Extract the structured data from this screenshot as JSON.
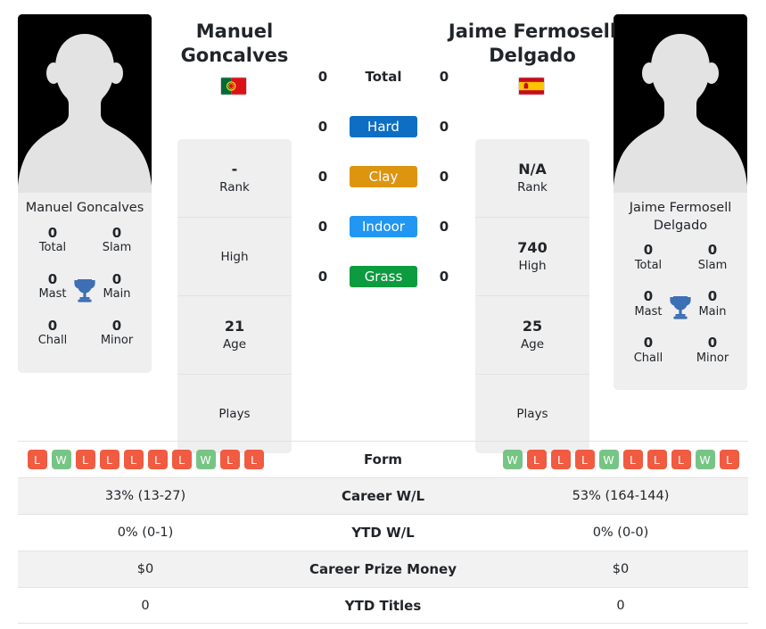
{
  "players": {
    "left": {
      "name": "Manuel\nGoncalves",
      "photo_name": "Manuel\nGoncalves",
      "country": "Portugal",
      "flag_icon": "flag-portugal-icon",
      "titles": [
        {
          "value": "0",
          "label": "Total"
        },
        {
          "value": "0",
          "label": "Slam"
        },
        {
          "value": "0",
          "label": "Mast"
        },
        {
          "value": "0",
          "label": "Main"
        },
        {
          "value": "0",
          "label": "Chall"
        },
        {
          "value": "0",
          "label": "Minor"
        }
      ],
      "info": [
        {
          "value": "-",
          "label": "Rank"
        },
        {
          "value": "",
          "label": "High"
        },
        {
          "value": "21",
          "label": "Age"
        },
        {
          "value": "",
          "label": "Plays"
        }
      ],
      "surface_wins": [
        "0",
        "0",
        "0",
        "0",
        "0"
      ],
      "form": [
        "L",
        "W",
        "L",
        "L",
        "L",
        "L",
        "L",
        "W",
        "L",
        "L"
      ],
      "career_wl": "33% (13-27)",
      "ytd_wl": "0% (0-1)",
      "career_prize_money": "$0",
      "ytd_titles": "0"
    },
    "right": {
      "name": "Jaime Fermosell\nDelgado",
      "photo_name": "Jaime Fermosell\nDelgado",
      "country": "Spain",
      "flag_icon": "flag-spain-icon",
      "titles": [
        {
          "value": "0",
          "label": "Total"
        },
        {
          "value": "0",
          "label": "Slam"
        },
        {
          "value": "0",
          "label": "Mast"
        },
        {
          "value": "0",
          "label": "Main"
        },
        {
          "value": "0",
          "label": "Chall"
        },
        {
          "value": "0",
          "label": "Minor"
        }
      ],
      "info": [
        {
          "value": "N/A",
          "label": "Rank"
        },
        {
          "value": "740",
          "label": "High"
        },
        {
          "value": "25",
          "label": "Age"
        },
        {
          "value": "",
          "label": "Plays"
        }
      ],
      "surface_wins": [
        "0",
        "0",
        "0",
        "0",
        "0"
      ],
      "form": [
        "W",
        "L",
        "L",
        "L",
        "W",
        "L",
        "L",
        "L",
        "W",
        "L"
      ],
      "career_wl": "53% (164-144)",
      "ytd_wl": "0% (0-0)",
      "career_prize_money": "$0",
      "ytd_titles": "0"
    }
  },
  "surfaces": [
    {
      "label": "Total",
      "color": "",
      "text_color": "#212529",
      "is_badge": false
    },
    {
      "label": "Hard",
      "color": "#0d6ec4",
      "text_color": "#ffffff",
      "is_badge": true
    },
    {
      "label": "Clay",
      "color": "#dd9510",
      "text_color": "#ffffff",
      "is_badge": true
    },
    {
      "label": "Indoor",
      "color": "#2196f3",
      "text_color": "#ffffff",
      "is_badge": true
    },
    {
      "label": "Grass",
      "color": "#0c9b3e",
      "text_color": "#ffffff",
      "is_badge": true
    }
  ],
  "table_rows": [
    {
      "label": "Form",
      "key": "form",
      "type": "form"
    },
    {
      "label": "Career W/L",
      "key": "career_wl",
      "type": "text"
    },
    {
      "label": "YTD W/L",
      "key": "ytd_wl",
      "type": "text"
    },
    {
      "label": "Career Prize Money",
      "key": "career_prize_money",
      "type": "text"
    },
    {
      "label": "YTD Titles",
      "key": "ytd_titles",
      "type": "text"
    }
  ],
  "colors": {
    "win": "#76c584",
    "loss": "#f05b41",
    "card_bg": "#efeff0",
    "trophy": "#3d6fb4",
    "row_shade": "#f2f2f3"
  },
  "icons": {
    "trophy": "trophy-icon",
    "silhouette": "player-silhouette-icon"
  }
}
